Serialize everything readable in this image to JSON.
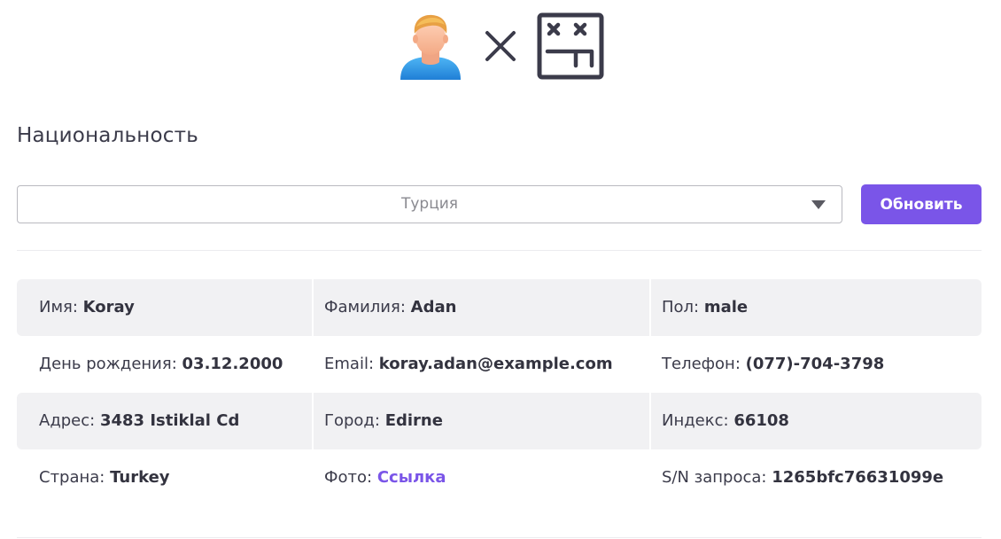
{
  "hero": {
    "user_icon": "user-avatar-icon",
    "times_icon": "times-icon",
    "flag_icon": "nationality-flag-icon"
  },
  "nationality": {
    "title": "Национальность",
    "selected": "Турция",
    "caret_icon": "caret-down-icon",
    "update_label": "Обновить",
    "accent_color": "#7a55e8"
  },
  "info": {
    "rows": [
      [
        {
          "label": "Имя:",
          "value": "Koray"
        },
        {
          "label": "Фамилия:",
          "value": "Adan"
        },
        {
          "label": "Пол:",
          "value": "male"
        }
      ],
      [
        {
          "label": "День рождения:",
          "value": "03.12.2000"
        },
        {
          "label": "Email:",
          "value": "koray.adan@example.com"
        },
        {
          "label": "Телефон:",
          "value": "(077)-704-3798"
        }
      ],
      [
        {
          "label": "Адрес:",
          "value": "3483 Istiklal Cd"
        },
        {
          "label": "Город:",
          "value": "Edirne"
        },
        {
          "label": "Индекс:",
          "value": "66108"
        }
      ],
      [
        {
          "label": "Страна:",
          "value": "Turkey"
        },
        {
          "label": "Фото:",
          "value": "Ссылка"
        },
        {
          "label": "S/N запроса:",
          "value": "1265bfc76631099e"
        }
      ]
    ]
  }
}
